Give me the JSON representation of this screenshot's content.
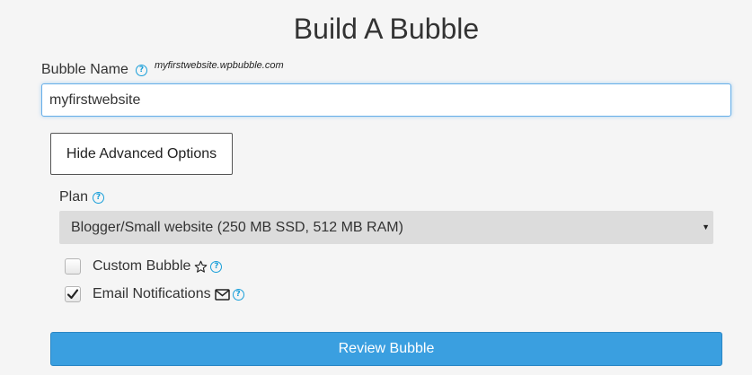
{
  "header": {
    "title": "Build A Bubble"
  },
  "bubble_name": {
    "label": "Bubble Name",
    "help_icon": "question-circle-icon",
    "domain_hint": "myfirstwebsite.wpbubble.com",
    "value": "myfirstwebsite"
  },
  "advanced": {
    "toggle_label": "Hide Advanced Options"
  },
  "plan": {
    "label": "Plan",
    "help_icon": "question-circle-icon",
    "selected": "Blogger/Small website (250 MB SSD, 512 MB RAM)"
  },
  "options": {
    "custom_bubble": {
      "label": "Custom Bubble",
      "checked": false,
      "icon": "star-outline-icon"
    },
    "email_notifications": {
      "label": "Email Notifications",
      "checked": true,
      "icon": "envelope-icon"
    }
  },
  "actions": {
    "review_label": "Review Bubble"
  },
  "colors": {
    "accent": "#3a9fe0",
    "help": "#1a9fd9",
    "focus_border": "#66afe9",
    "select_bg": "#dcdcdc",
    "background": "#f5f5f5"
  }
}
